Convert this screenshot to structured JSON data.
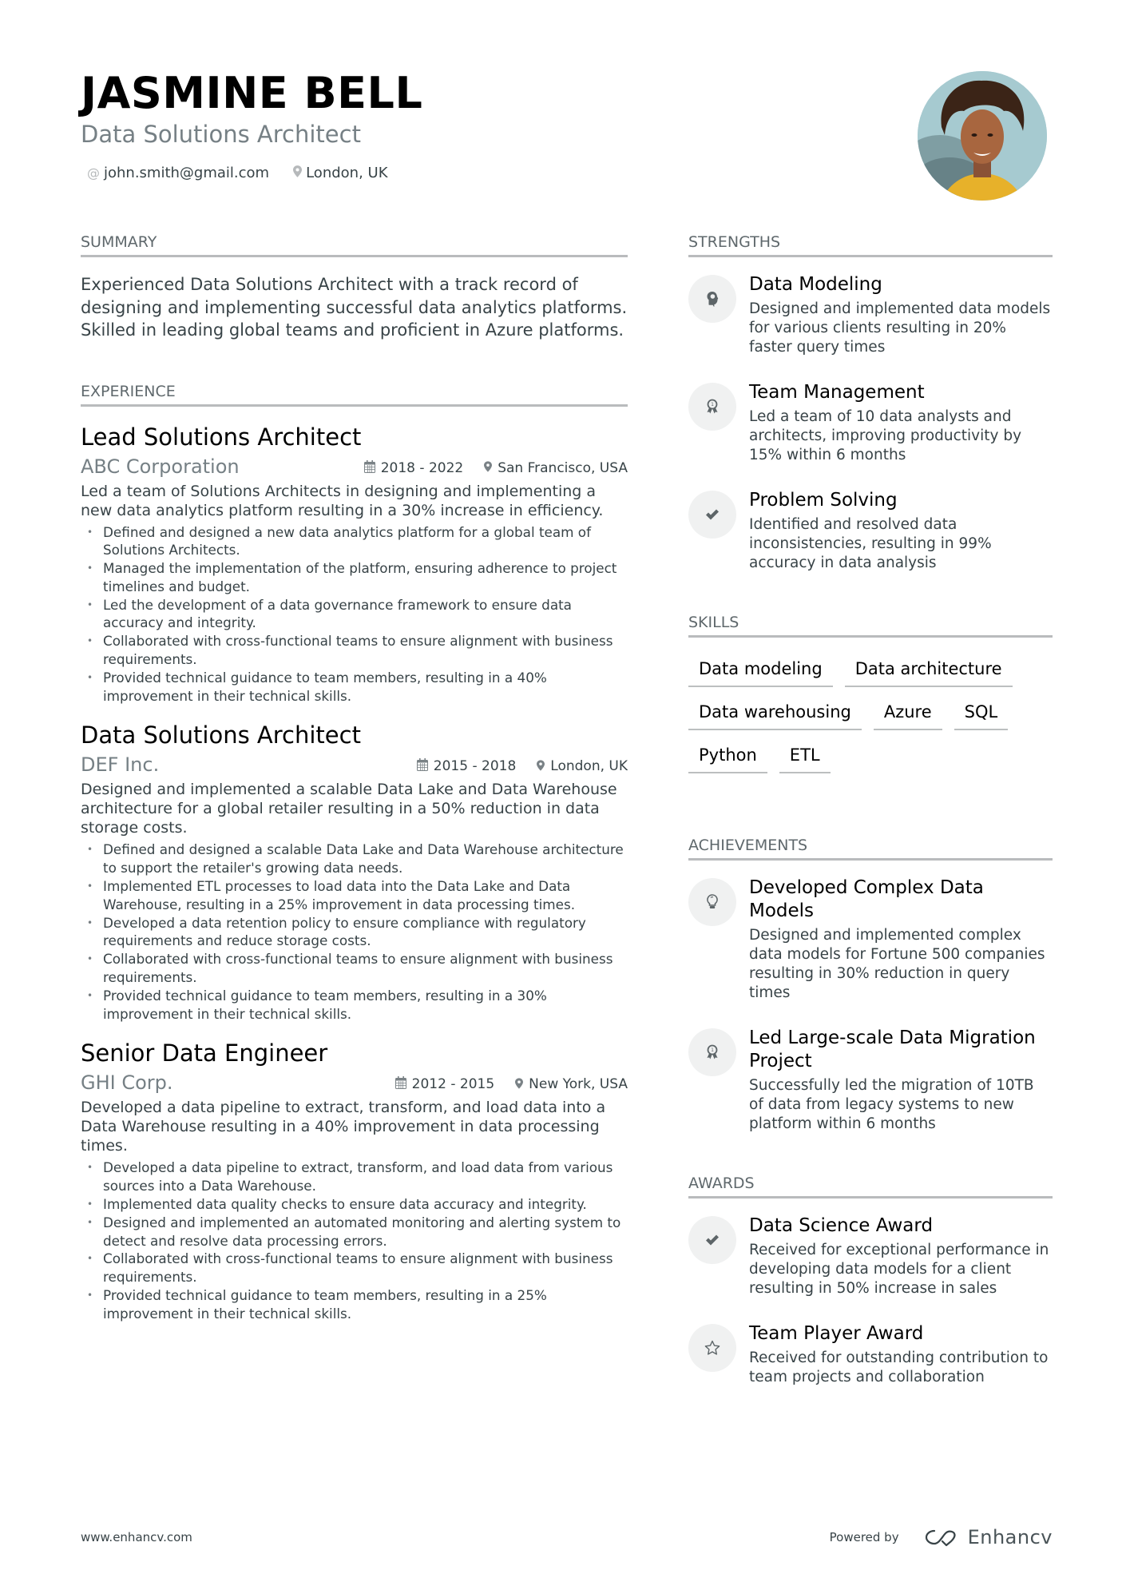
{
  "header": {
    "name": "JASMINE BELL",
    "title": "Data Solutions Architect",
    "email_icon": "at-icon",
    "email": "john.smith@gmail.com",
    "location_icon": "map-pin-icon",
    "location": "London, UK",
    "photo": "profile-photo"
  },
  "summary": {
    "heading": "SUMMARY",
    "text": "Experienced Data Solutions Architect with a track record of designing and implementing successful data analytics platforms. Skilled in leading global teams and proficient in Azure platforms."
  },
  "experience": {
    "heading": "EXPERIENCE",
    "jobs": [
      {
        "title": "Lead Solutions Architect",
        "company": "ABC Corporation",
        "dates": "2018 - 2022",
        "location": "San Francisco, USA",
        "description": "Led a team of Solutions Architects in designing and implementing a new data analytics platform resulting in a 30% increase in efficiency.",
        "bullets": [
          "Defined and designed a new data analytics platform for a global team of Solutions Architects.",
          "Managed the implementation of the platform, ensuring adherence to project timelines and budget.",
          "Led the development of a data governance framework to ensure data accuracy and integrity.",
          "Collaborated with cross-functional teams to ensure alignment with business requirements.",
          "Provided technical guidance to team members, resulting in a 40% improvement in their technical skills."
        ]
      },
      {
        "title": "Data Solutions Architect",
        "company": "DEF Inc.",
        "dates": "2015 - 2018",
        "location": "London, UK",
        "description": "Designed and implemented a scalable Data Lake and Data Warehouse architecture for a global retailer resulting in a 50% reduction in data storage costs.",
        "bullets": [
          "Defined and designed a scalable Data Lake and Data Warehouse architecture to support the retailer's growing data needs.",
          "Implemented ETL processes to load data into the Data Lake and Data Warehouse, resulting in a 25% improvement in data processing times.",
          "Developed a data retention policy to ensure compliance with regulatory requirements and reduce storage costs.",
          "Collaborated with cross-functional teams to ensure alignment with business requirements.",
          "Provided technical guidance to team members, resulting in a 30% improvement in their technical skills."
        ]
      },
      {
        "title": "Senior Data Engineer",
        "company": "GHI Corp.",
        "dates": "2012 - 2015",
        "location": "New York, USA",
        "description": "Developed a data pipeline to extract, transform, and load data into a Data Warehouse resulting in a 40% improvement in data processing times.",
        "bullets": [
          "Developed a data pipeline to extract, transform, and load data from various sources into a Data Warehouse.",
          "Implemented data quality checks to ensure data accuracy and integrity.",
          "Designed and implemented an automated monitoring and alerting system to detect and resolve data processing errors.",
          "Collaborated with cross-functional teams to ensure alignment with business requirements.",
          "Provided technical guidance to team members, resulting in a 25% improvement in their technical skills."
        ]
      }
    ]
  },
  "strengths": {
    "heading": "STRENGTHS",
    "items": [
      {
        "icon": "brain-head-icon",
        "title": "Data Modeling",
        "description": "Designed and implemented data models for various clients resulting in 20% faster query times"
      },
      {
        "icon": "award-ribbon-icon",
        "title": "Team Management",
        "description": "Led a team of 10 data analysts and architects, improving productivity by 15% within 6 months"
      },
      {
        "icon": "checkmark-icon",
        "title": "Problem Solving",
        "description": "Identified and resolved data inconsistencies, resulting in 99% accuracy in data analysis"
      }
    ]
  },
  "skills": {
    "heading": "SKILLS",
    "items": [
      "Data modeling",
      "Data architecture",
      "Data warehousing",
      "Azure",
      "SQL",
      "Python",
      "ETL"
    ]
  },
  "achievements": {
    "heading": "ACHIEVEMENTS",
    "items": [
      {
        "icon": "lightbulb-icon",
        "title": "Developed Complex Data Models",
        "description": "Designed and implemented complex data models for Fortune 500 companies resulting in 30% reduction in query times"
      },
      {
        "icon": "award-ribbon-icon",
        "title": "Led Large-scale Data Migration Project",
        "description": "Successfully led the migration of 10TB of data from legacy systems to new platform within 6 months"
      }
    ]
  },
  "awards": {
    "heading": "AWARDS",
    "items": [
      {
        "icon": "checkmark-icon",
        "title": "Data Science Award",
        "description": "Received for exceptional performance in developing data models for a client resulting in 50% increase in sales"
      },
      {
        "icon": "star-icon",
        "title": "Team Player Award",
        "description": "Received for outstanding contribution to team projects and collaboration"
      }
    ]
  },
  "footer": {
    "website": "www.enhancv.com",
    "powered_by": "Powered by",
    "brand": "Enhancv"
  }
}
